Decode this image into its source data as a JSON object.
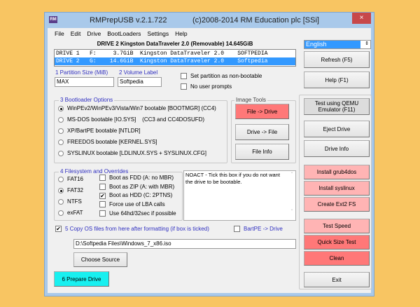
{
  "window": {
    "app_title": "RMPrepUSB v.2.1.722",
    "copyright": "(c)2008-2014 RM Education plc [SSi]",
    "close": "×",
    "logo": "RM"
  },
  "menu": [
    "File",
    "Edit",
    "Drive",
    "BootLoaders",
    "Settings",
    "Help"
  ],
  "drive_header": "DRIVE 2 Kingston DataTraveler 2.0  (Removable) 14.645GiB",
  "drives": [
    {
      "text": "DRIVE 1   F:     3.7GiB  Kingston DataTraveler 2.0    SOFTPEDIA",
      "selected": false
    },
    {
      "text": "DRIVE 2   G:    14.6GiB  Kingston DataTraveler 2.0    Softpedia",
      "selected": true
    }
  ],
  "language": "English",
  "partition": {
    "size_label": "1 Partition Size (MiB)",
    "size_value": "MAX",
    "volume_label": "2 Volume Label",
    "volume_value": "Softpedia"
  },
  "options": {
    "non_bootable": {
      "label": "Set partition as non-bootable",
      "checked": false
    },
    "no_prompts": {
      "label": "No user prompts",
      "checked": false
    }
  },
  "bootloader": {
    "title": "3 Bootloader Options",
    "items": [
      {
        "label": "WinPEv2/WinPEv3/Vista/Win7 bootable [BOOTMGR] (CC4)",
        "selected": true
      },
      {
        "label": "MS-DOS bootable [IO.SYS]    (CC3 and CC4DOSUFD)",
        "selected": false
      },
      {
        "label": "XP/BartPE bootable [NTLDR]",
        "selected": false
      },
      {
        "label": "FREEDOS bootable [KERNEL.SYS]",
        "selected": false
      },
      {
        "label": "SYSLINUX bootable [LDLINUX.SYS + SYSLINUX.CFG]",
        "selected": false
      }
    ]
  },
  "image_tools": {
    "title": "Image Tools",
    "file_to_drive": "File -> Drive",
    "drive_to_file": "Drive -> File",
    "file_info": "File Info"
  },
  "filesystem": {
    "title": "4 Filesystem and Overrides",
    "types": [
      {
        "label": "FAT16",
        "selected": false
      },
      {
        "label": "FAT32",
        "selected": true
      },
      {
        "label": "NTFS",
        "selected": false
      },
      {
        "label": "exFAT",
        "selected": false
      }
    ],
    "overrides": [
      {
        "label": "Boot as FDD (A: no MBR)",
        "checked": false
      },
      {
        "label": "Boot as ZIP (A: with MBR)",
        "checked": false
      },
      {
        "label": "Boot as HDD (C: 2PTNS)",
        "checked": true
      },
      {
        "label": "Force use of LBA calls",
        "checked": false
      },
      {
        "label": "Use 64hd/32sec if possible",
        "checked": false
      }
    ]
  },
  "help_text": "NOACT - Tick this box if you do not want the drive to be bootable.",
  "copy": {
    "label": "5 Copy OS files from here after formatting (if box is ticked)",
    "checked": true,
    "bartpe_label": "BartPE -> Drive",
    "bartpe_checked": false,
    "path": "D:\\Softpedia Files\\Windows_7_x86.iso",
    "choose_source": "Choose Source"
  },
  "prepare": "6 Prepare Drive",
  "right": {
    "refresh": "Refresh (F5)",
    "help": "Help (F1)",
    "qemu": "Test using QEMU Emulator (F11)",
    "eject": "Eject Drive",
    "drive_info": "Drive Info",
    "grub4dos": "Install grub4dos",
    "syslinux": "Install syslinux",
    "ext2": "Create Ext2 FS",
    "test_speed": "Test Speed",
    "quick_size": "Quick Size Test",
    "clean": "Clean",
    "exit": "Exit"
  }
}
